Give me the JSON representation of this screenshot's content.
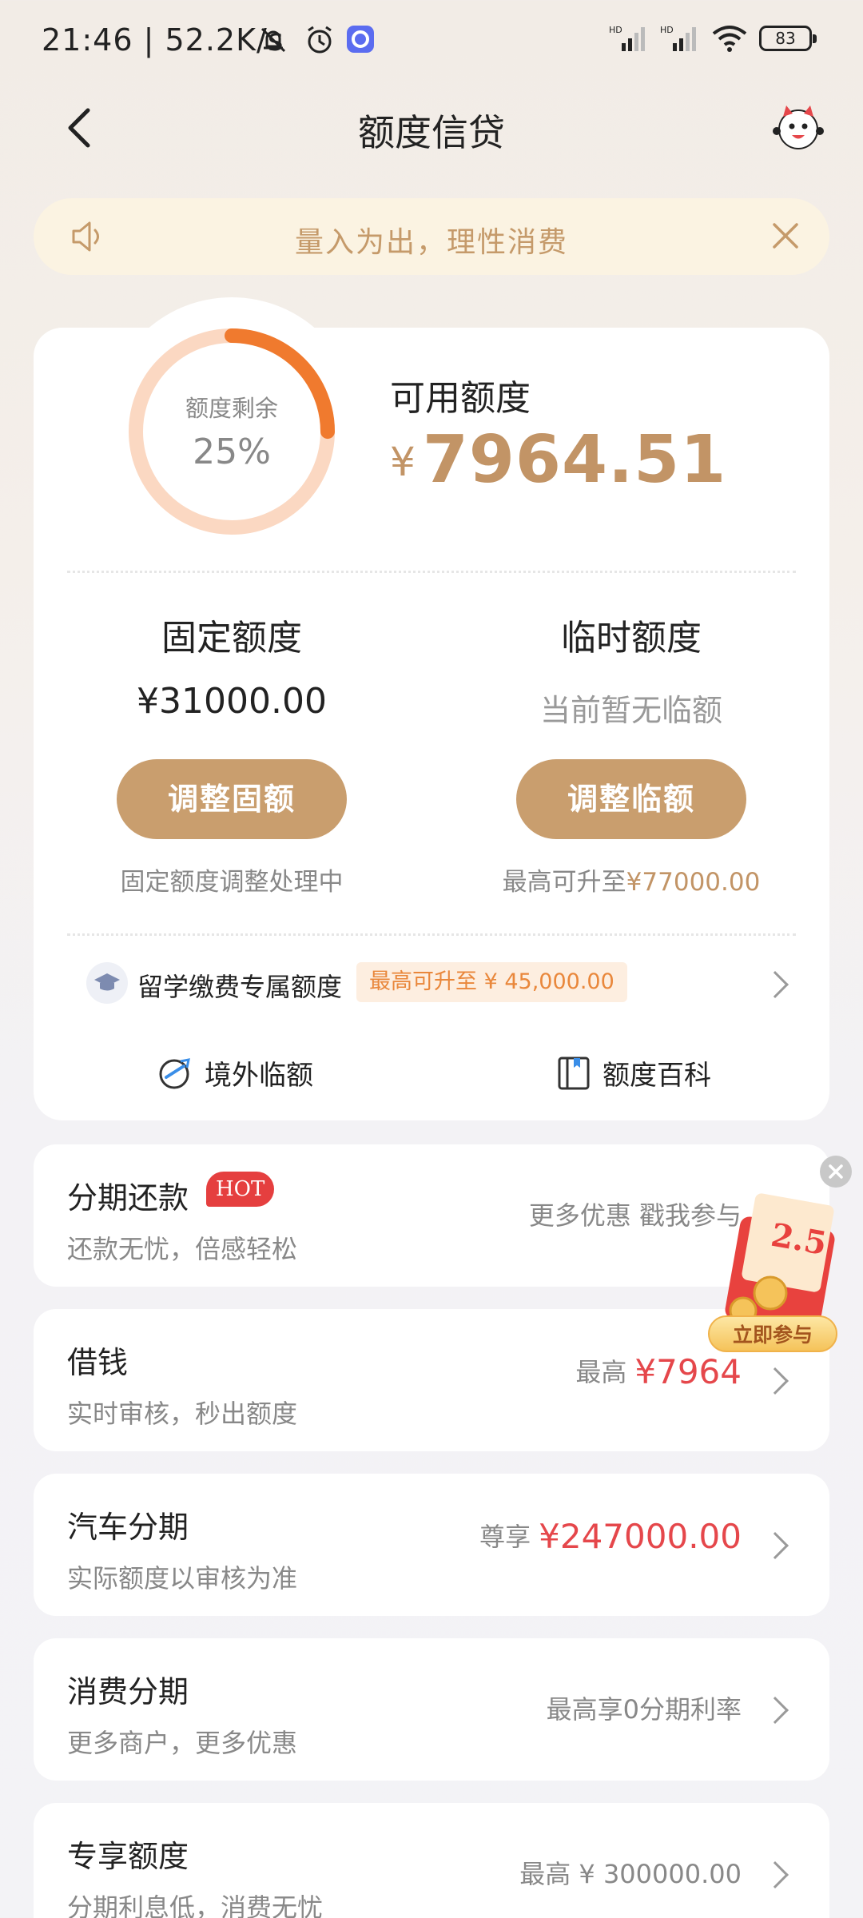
{
  "status_bar": {
    "time": "21:46 | 52.2K/s",
    "battery": "83",
    "icons": [
      "mute-icon",
      "alarm-icon",
      "app-icon",
      "signal-hd-icon",
      "signal-hd-icon",
      "wifi-icon",
      "battery-icon"
    ]
  },
  "header": {
    "title": "额度信贷",
    "back_icon": "back-arrow-icon",
    "avatar_icon": "mascot-avatar-icon"
  },
  "notice": {
    "text": "量入为出，理性消费",
    "icon": "speaker-icon",
    "close_icon": "close-icon"
  },
  "credit": {
    "ring_label": "额度剩余",
    "ring_percent_text": "25%",
    "remaining_fraction": 0.25,
    "available_label": "可用额度",
    "available_yen": "¥",
    "available_amount": "7964.51",
    "fixed": {
      "title": "固定额度",
      "value": "¥31000.00",
      "button": "调整固额",
      "note": "固定额度调整处理中"
    },
    "temp": {
      "title": "临时额度",
      "value": "当前暂无临额",
      "button": "调整临额",
      "note_prefix": "最高可升至",
      "note_amount": "¥77000.00"
    },
    "study": {
      "label": "留学缴费专属额度",
      "tag": "最高可升至 ¥ 45,000.00"
    },
    "quick_links": [
      {
        "label": "境外临额",
        "icon": "globe-plane-icon"
      },
      {
        "label": "额度百科",
        "icon": "book-icon"
      }
    ]
  },
  "list": [
    {
      "title": "分期还款",
      "badge": "HOT",
      "subtitle": "还款无忧，倍感轻松",
      "right": "更多优惠 戳我参与"
    },
    {
      "title": "借钱",
      "subtitle": "实时审核，秒出额度",
      "right_prefix": "最高",
      "right_value": "¥7964"
    },
    {
      "title": "汽车分期",
      "subtitle": "实际额度以审核为准",
      "right_prefix": "尊享",
      "right_value": "¥247000.00"
    },
    {
      "title": "消费分期",
      "subtitle": "更多商户，更多优惠",
      "right": "最高享0分期利率"
    },
    {
      "title": "专享额度",
      "subtitle": "分期利息低，消费无忧",
      "right": "最高 ¥ 300000.00"
    }
  ],
  "promo": {
    "badge": "2.5",
    "button": "立即参与",
    "close_icon": "close-icon"
  },
  "colors": {
    "gold": "#c29466",
    "button_gold": "#c99e6e",
    "ring_orange": "#f07a2e",
    "ring_track": "#fbd8c2",
    "red": "#e5474b"
  }
}
